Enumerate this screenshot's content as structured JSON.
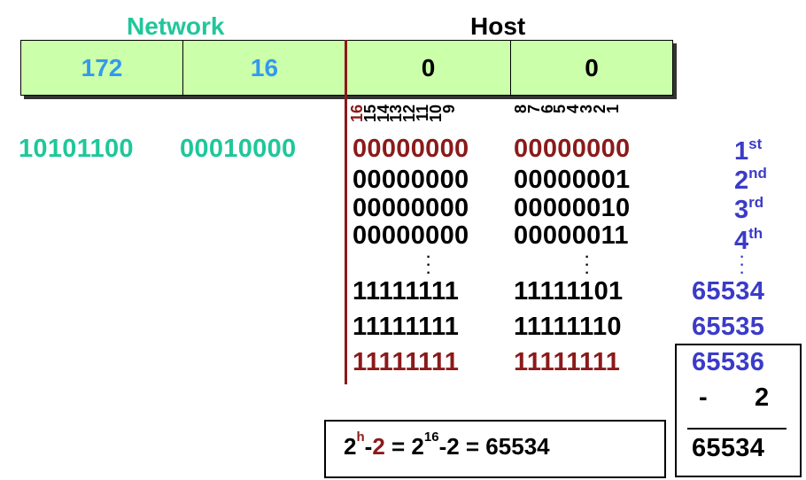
{
  "headers": {
    "network": "Network",
    "host": "Host"
  },
  "address_octets": [
    {
      "value": "172",
      "part": "network"
    },
    {
      "value": "16",
      "part": "network"
    },
    {
      "value": "0",
      "part": "host"
    },
    {
      "value": "0",
      "part": "host"
    }
  ],
  "bit_positions": [
    "16",
    "15",
    "14",
    "13",
    "12",
    "11",
    "10",
    "9",
    "8",
    "7",
    "6",
    "5",
    "4",
    "3",
    "2",
    "1"
  ],
  "network_binary": [
    "10101100",
    "00010000"
  ],
  "host_rows": [
    {
      "octet3": "00000000",
      "octet4": "00000000",
      "ordinal_num": "1",
      "ordinal_suffix": "st"
    },
    {
      "octet3": "00000000",
      "octet4": "00000001",
      "ordinal_num": "2",
      "ordinal_suffix": "nd"
    },
    {
      "octet3": "00000000",
      "octet4": "00000010",
      "ordinal_num": "3",
      "ordinal_suffix": "rd"
    },
    {
      "octet3": "00000000",
      "octet4": "00000011",
      "ordinal_num": "4",
      "ordinal_suffix": "th"
    },
    {
      "octet3": "11111111",
      "octet4": "11111101",
      "count": "65534"
    },
    {
      "octet3": "11111111",
      "octet4": "11111110",
      "count": "65535"
    },
    {
      "octet3": "11111111",
      "octet4": "11111111",
      "count": "65536"
    }
  ],
  "subtraction": {
    "minus": "-",
    "value": "2",
    "result": "65534"
  },
  "formula": {
    "base": "2",
    "exp": "h",
    "minus": "-",
    "two": "2",
    "eq1": " = 2",
    "exp2": "16",
    "rest": "-2 = 65534"
  },
  "colors": {
    "network_text": "#1fc79a",
    "octet_fill": "#ccffaa",
    "network_octet_text": "#3399ee",
    "boundary_red": "#8b1a1a",
    "count_blue": "#3b3bc8"
  }
}
